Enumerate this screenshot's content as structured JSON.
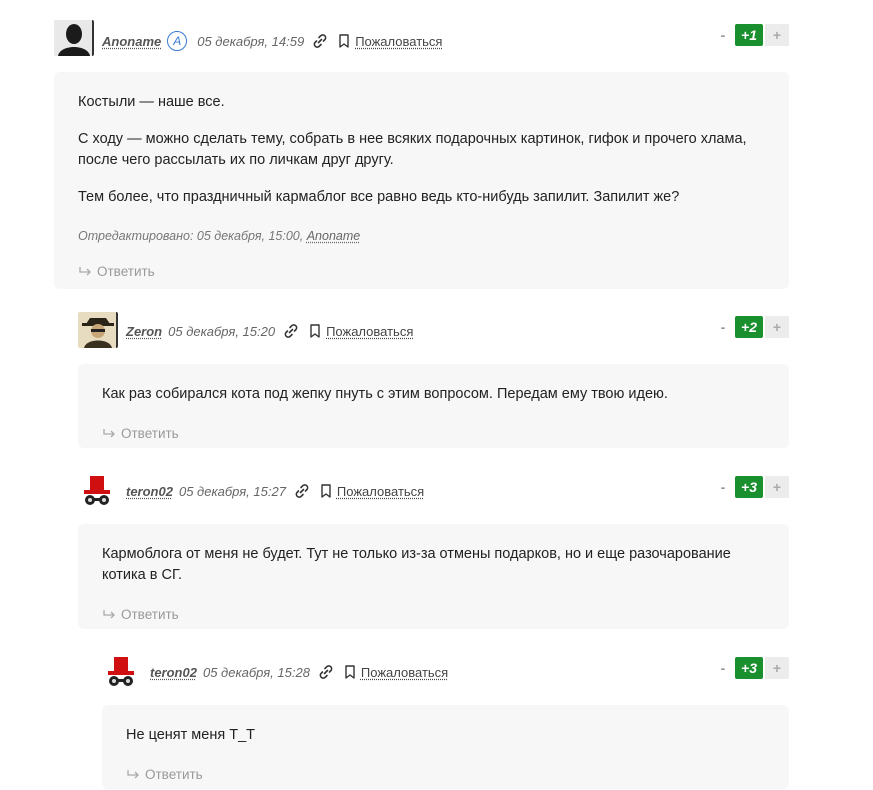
{
  "colors": {
    "vote_green": "#1a8f2e",
    "body_bg": "#f7f7f7",
    "badge_blue": "#3a7bd5"
  },
  "report_label": "Пожаловаться",
  "reply_label": "Ответить",
  "vote_minus": "-",
  "vote_plus": "+",
  "comments": [
    {
      "author": "Anoname",
      "badge": "A",
      "date": "05 декабря, 14:59",
      "score": "+1",
      "paragraphs": [
        "Костыли — наше все.",
        "С ходу — можно сделать тему, собрать в нее всяких подарочных картинок, гифок и прочего хлама, после чего рассылать их по личкам друг другу.",
        "Тем более, что праздничный кармаблог все равно ведь кто-нибудь запилит. Запилит же?"
      ],
      "edited_prefix": "Отредактировано: 05 декабря, 15:00,",
      "edited_author": "Anoname"
    },
    {
      "author": "Zeron",
      "date": "05 декабря, 15:20",
      "score": "+2",
      "paragraphs": [
        "Как раз собирался кота под жепку пнуть с этим вопросом. Передам ему твою идею."
      ]
    },
    {
      "author": "teron02",
      "date": "05 декабря, 15:27",
      "score": "+3",
      "paragraphs": [
        "Кармоблога от меня не будет. Тут не только из-за отмены подарков, но и еще разочарование котика в СГ."
      ]
    },
    {
      "author": "teron02",
      "date": "05 декабря, 15:28",
      "score": "+3",
      "paragraphs": [
        "Не ценят меня T_T"
      ]
    }
  ]
}
